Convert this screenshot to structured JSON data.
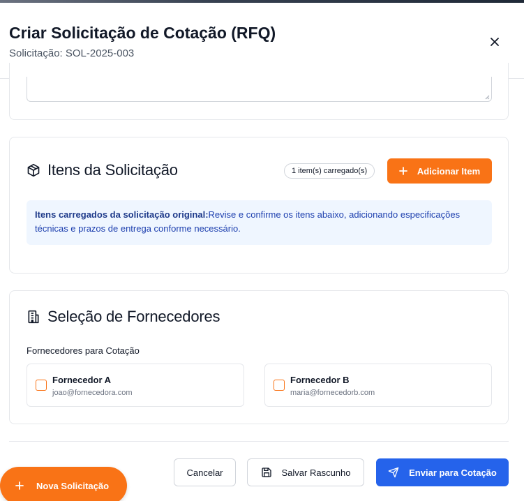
{
  "dialog": {
    "title": "Criar Solicitação de Cotação (RFQ)",
    "subtitle": "Solicitação: SOL-2025-003",
    "close_icon": "close-icon"
  },
  "items_section": {
    "icon": "package-icon",
    "title": "Itens da Solicitação",
    "badge": "1 item(s) carregado(s)",
    "add_button": "Adicionar Item",
    "info_bold": "Itens carregados da solicitação original:",
    "info_text": "Revise e confirme os itens abaixo, adicionando especificações técnicas e prazos de entrega conforme necessário."
  },
  "suppliers_section": {
    "icon": "building-icon",
    "title": "Seleção de Fornecedores",
    "label": "Fornecedores para Cotação",
    "suppliers": [
      {
        "name": "Fornecedor A",
        "email": "joao@fornecedora.com",
        "checked": false
      },
      {
        "name": "Fornecedor B",
        "email": "maria@fornecedorb.com",
        "checked": false
      }
    ]
  },
  "footer": {
    "cancel": "Cancelar",
    "save_draft": "Salvar Rascunho",
    "send": "Enviar para Cotação"
  },
  "fab": {
    "label": "Nova Solicitação"
  },
  "colors": {
    "accent_orange": "#f97316",
    "primary_blue": "#2563eb",
    "info_bg": "#eff6ff"
  }
}
